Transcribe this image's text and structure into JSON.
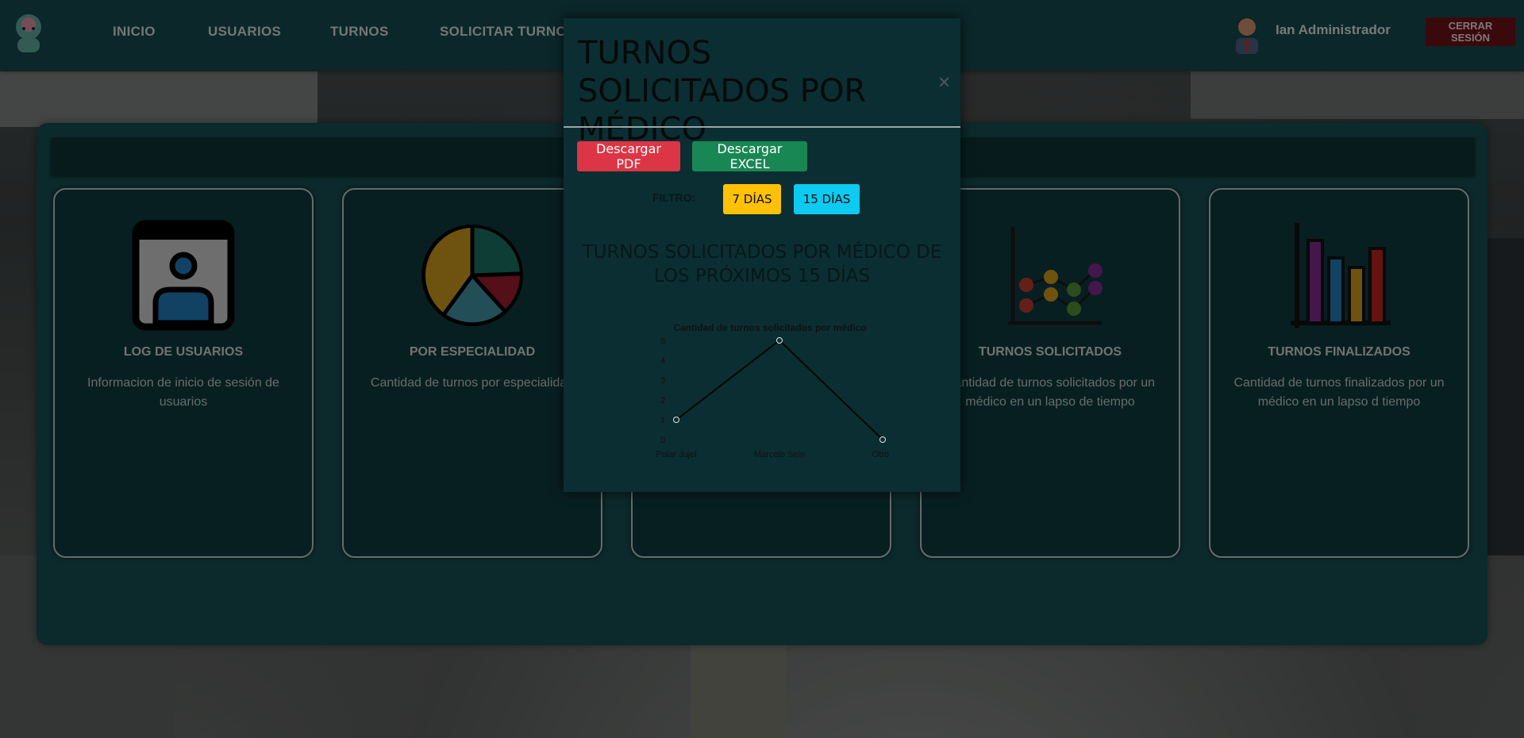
{
  "nav": {
    "items": [
      "INICIO",
      "USUARIOS",
      "TURNOS",
      "SOLICITAR TURNO"
    ],
    "user_name": "Ian Administrador",
    "logout_label": "CERRAR SESIÓN"
  },
  "cards": [
    {
      "title": "LOG DE USUARIOS",
      "desc": "Informacion de inicio de sesión de usuarios",
      "icon": "user-profile-icon"
    },
    {
      "title": "POR ESPECIALIDAD",
      "desc": "Cantidad de turnos por especialidad",
      "icon": "pie-chart-icon"
    },
    {
      "title": "",
      "desc": "",
      "icon": ""
    },
    {
      "title": "TURNOS SOLICITADOS",
      "desc": "Cantidad de turnos solicitados por un médico en un lapso de tiempo",
      "icon": "scatter-chart-icon"
    },
    {
      "title": "TURNOS FINALIZADOS",
      "desc": "Cantidad de turnos finalizados por un médico en un lapso d tiempo",
      "icon": "bar-chart-icon"
    }
  ],
  "modal": {
    "title": "TURNOS SOLICITADOS POR MÉDICO",
    "close": "×",
    "pdf_label": "Descargar PDF",
    "excel_label": "Descargar EXCEL",
    "filter_label": "FILTRO:",
    "filter_7": "7 DÍAS",
    "filter_15": "15 DÍAS",
    "chart_heading": "TURNOS SOLICITADOS POR MÉDICO DE LOS PRÓXIMOS 15 DÍAS"
  },
  "colors": {
    "navbar": "#15474d",
    "panel": "#174b4f",
    "pdf": "#dc3545",
    "excel": "#198754",
    "warning": "#ffc107",
    "info": "#0dcaf0",
    "logout": "#6a1216"
  },
  "chart_data": {
    "type": "line",
    "title": "Cantidad de turnos solicitados por médico",
    "categories": [
      "Polar Jujel",
      "Marcelo Sein",
      "Otros"
    ],
    "values": [
      1,
      5,
      0
    ],
    "ylim": [
      0,
      5
    ],
    "yticks": [
      "0",
      "1",
      "2",
      "3",
      "4",
      "5"
    ],
    "grid": false,
    "legend": "none"
  }
}
